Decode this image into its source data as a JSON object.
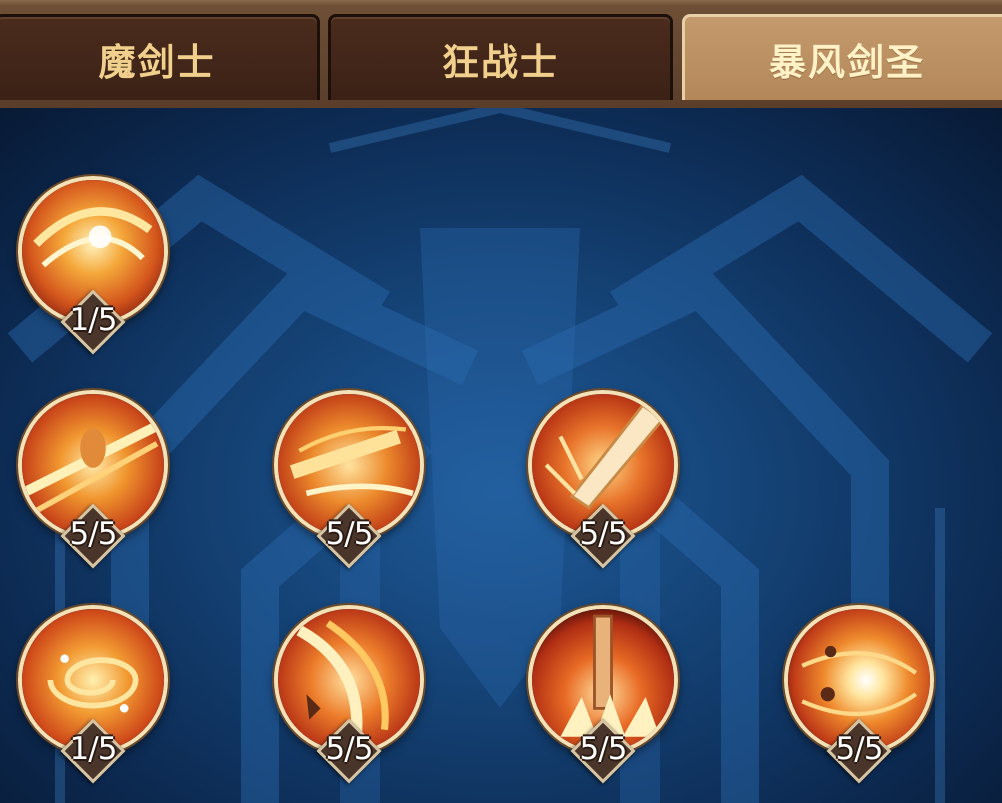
{
  "tabs": [
    {
      "label": "魔剑士",
      "selected": false
    },
    {
      "label": "狂战士",
      "selected": false
    },
    {
      "label": "暴风剑圣",
      "selected": true
    }
  ],
  "colors": {
    "tab_bar": "#5a3e2a",
    "tab_inactive": "#3b2116",
    "tab_active": "#b3875a",
    "tab_text": "#f0d08c",
    "background": "#154478",
    "icon_frame": "#f4e2b6",
    "connector": "#f2d25a"
  },
  "skills": [
    {
      "icon": "slash-swirl-icon",
      "level": "1/5"
    },
    {
      "icon": "charging-warrior-icon",
      "level": "5/5"
    },
    {
      "icon": "dash-strike-icon",
      "level": "5/5"
    },
    {
      "icon": "great-sword-icon",
      "level": "5/5"
    },
    {
      "icon": "whirlwind-icon",
      "level": "1/5"
    },
    {
      "icon": "flame-slash-icon",
      "level": "5/5"
    },
    {
      "icon": "ground-sword-icon",
      "level": "5/5"
    },
    {
      "icon": "vortex-burst-icon",
      "level": "5/5"
    }
  ]
}
